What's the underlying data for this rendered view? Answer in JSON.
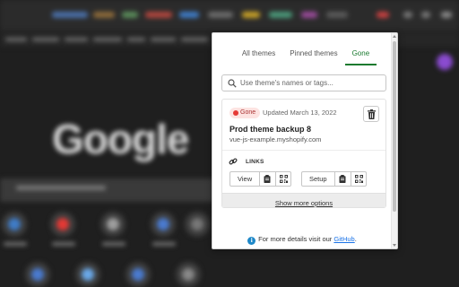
{
  "tabs": [
    {
      "label": "All themes"
    },
    {
      "label": "Pinned themes"
    },
    {
      "label": "Gone"
    }
  ],
  "search": {
    "placeholder": "Use theme's names or tags..."
  },
  "theme": {
    "status": "Gone",
    "updated": "Updated March 13, 2022",
    "name": "Prod theme backup 8",
    "domain": "vue-js-example.myshopify.com"
  },
  "links": {
    "label": "LINKS",
    "view_label": "View",
    "setup_label": "Setup"
  },
  "more_options": "Show more options",
  "footer": {
    "text": "For more details visit our",
    "link": "GitHub",
    "suffix": "."
  },
  "background": {
    "logo": "Google"
  },
  "colors": {
    "accent": "#1a7a2f",
    "gone_badge": "#fde3e1",
    "link": "#1a73e8"
  }
}
